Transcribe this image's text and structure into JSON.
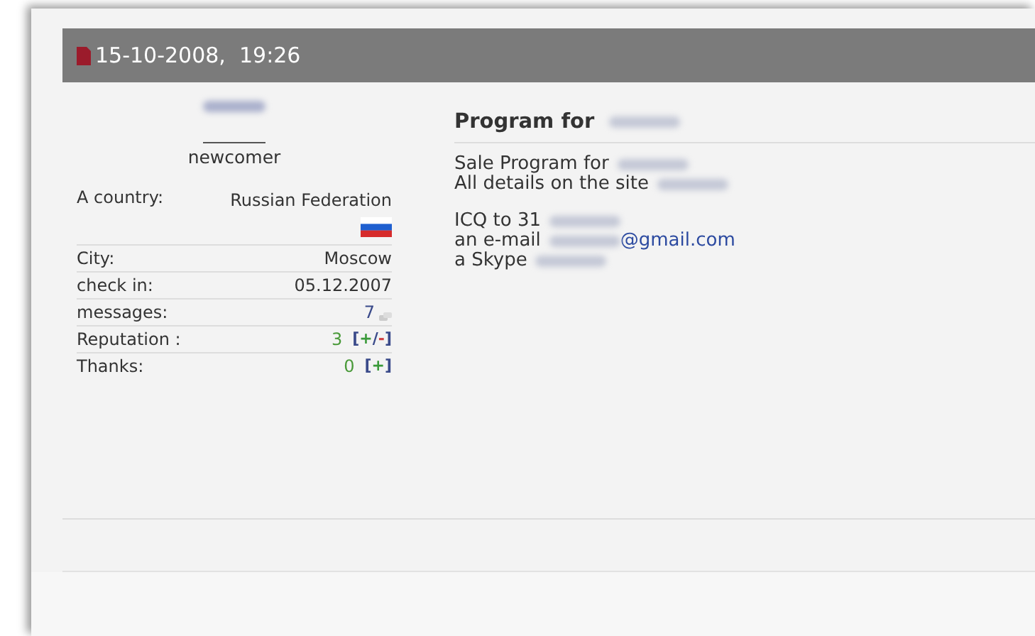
{
  "post": {
    "date": "15-10-2008,  19:26"
  },
  "user": {
    "name_redacted": true,
    "rank": "newcomer",
    "fields": [
      {
        "kind": "country",
        "label": "A country:",
        "value": "Russian Federation"
      },
      {
        "kind": "plain",
        "label": "City:",
        "value": "Moscow"
      },
      {
        "kind": "plain",
        "label": "check in:",
        "value": "05.12.2007"
      },
      {
        "kind": "messages",
        "label": "messages:",
        "value": "7"
      },
      {
        "kind": "score",
        "label": "Reputation :",
        "value": "3",
        "links": [
          {
            "kind": "bracket",
            "text": "["
          },
          {
            "kind": "plus",
            "text": "+"
          },
          {
            "kind": "bracket",
            "text": "/"
          },
          {
            "kind": "minus",
            "text": "-"
          },
          {
            "kind": "bracket",
            "text": "]"
          }
        ]
      },
      {
        "kind": "score",
        "label": "Thanks:",
        "value": "0",
        "links": [
          {
            "kind": "bracket",
            "text": "["
          },
          {
            "kind": "plus",
            "text": "+"
          },
          {
            "kind": "bracket",
            "text": "]"
          }
        ]
      }
    ]
  },
  "message": {
    "title": [
      {
        "kind": "text",
        "text": "Program for"
      },
      {
        "kind": "redacted"
      }
    ],
    "paragraphs": [
      [
        [
          {
            "kind": "text",
            "text": "Sale Program for"
          },
          {
            "kind": "redacted"
          }
        ],
        [
          {
            "kind": "text",
            "text": "All details on the site"
          },
          {
            "kind": "redacted"
          }
        ]
      ],
      [
        [
          {
            "kind": "text",
            "text": "ICQ to 31"
          },
          {
            "kind": "redacted"
          }
        ],
        [
          {
            "kind": "text",
            "text": "an e-mail"
          },
          {
            "kind": "redacted"
          },
          {
            "kind": "link",
            "text": "@gmail.com"
          }
        ],
        [
          {
            "kind": "text",
            "text": "a Skype"
          },
          {
            "kind": "redacted"
          }
        ]
      ]
    ]
  }
}
